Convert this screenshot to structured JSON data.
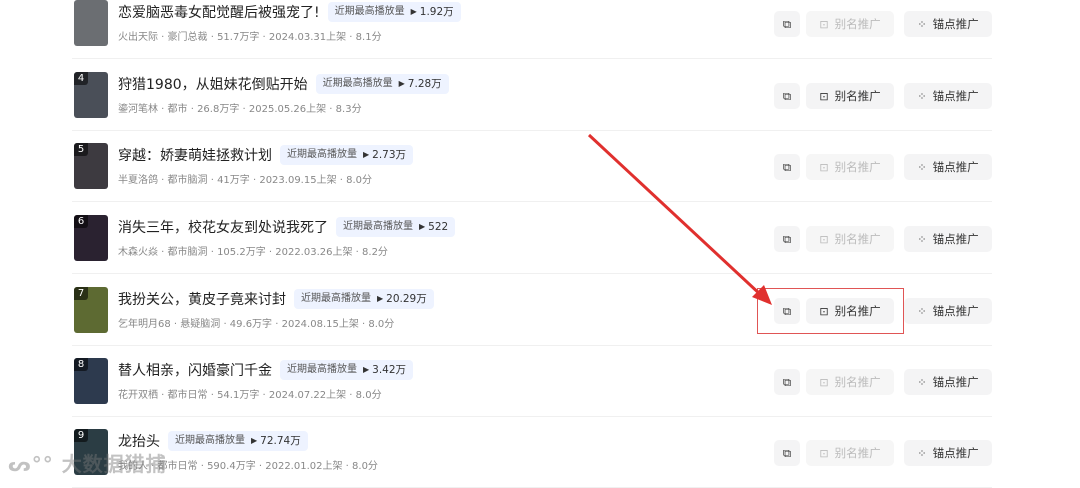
{
  "hot_label": "近期最高播放量",
  "buttons": {
    "alias": "别名推广",
    "anchor": "锚点推广"
  },
  "rows": [
    {
      "rank": "",
      "title": "恋爱脑恶毒女配觉醒后被强宠了!",
      "plays": "1.92万",
      "meta": "火出天际 · 豪门总裁 · 51.7万字 · 2024.03.31上架 · 8.1分",
      "cover": "#6b6e72",
      "alias_active": false
    },
    {
      "rank": "4",
      "title": "狩猎1980，从姐妹花倒贴开始",
      "plays": "7.28万",
      "meta": "鎏河笔林 · 都市 · 26.8万字 · 2025.05.26上架 · 8.3分",
      "cover": "#4a4f58",
      "alias_active": true
    },
    {
      "rank": "5",
      "title": "穿越：娇妻萌娃拯救计划",
      "plays": "2.73万",
      "meta": "半夏洛鸽 · 都市脑洞 · 41万字 · 2023.09.15上架 · 8.0分",
      "cover": "#3d3a40",
      "alias_active": false
    },
    {
      "rank": "6",
      "title": "消失三年，校花女友到处说我死了",
      "plays": "522",
      "meta": "木森火焱 · 都市脑洞 · 105.2万字 · 2022.03.26上架 · 8.2分",
      "cover": "#2a2230",
      "alias_active": false
    },
    {
      "rank": "7",
      "title": "我扮关公，黄皮子竟来讨封",
      "plays": "20.29万",
      "meta": "乞年明月68 · 悬疑脑洞 · 49.6万字 · 2024.08.15上架 · 8.0分",
      "cover": "#5d6a32",
      "alias_active": true
    },
    {
      "rank": "8",
      "title": "替人相亲，闪婚豪门千金",
      "plays": "3.42万",
      "meta": "花开双栖 · 都市日常 · 54.1万字 · 2024.07.22上架 · 8.0分",
      "cover": "#2d3a4e",
      "alias_active": false
    },
    {
      "rank": "9",
      "title": "龙抬头",
      "plays": "72.74万",
      "meta": "我的人 · 都市日常 · 590.4万字 · 2022.01.02上架 · 8.0分",
      "cover": "#2b3d44",
      "alias_active": false
    }
  ],
  "watermark": "大数据猎捕"
}
